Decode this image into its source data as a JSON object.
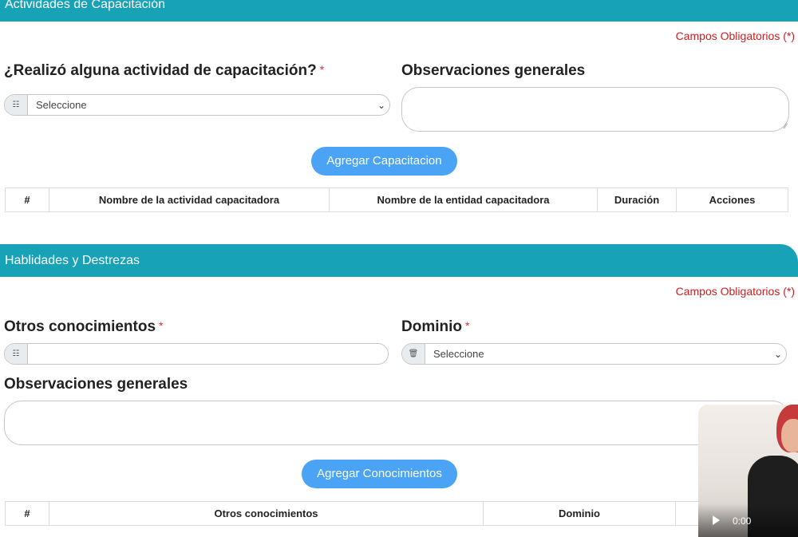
{
  "section1": {
    "title": "Actividades de Capacitación",
    "required_note": "Campos Obligatorios (*)",
    "question_label": "¿Realizó alguna actividad de capacitación?",
    "required_star": "*",
    "select_value": "Seleccione",
    "observations_label": "Observaciones generales",
    "add_button": "Agregar Capacitacion",
    "table_headers": [
      "#",
      "Nombre de la actividad capacitadora",
      "Nombre de la entidad capacitadora",
      "Duración",
      "Acciones"
    ]
  },
  "section2": {
    "title": "Hablidades y Destrezas",
    "required_note": "Campos Obligatorios (*)",
    "other_knowledge_label": "Otros conocimientos",
    "domain_label": "Dominio",
    "required_star": "*",
    "domain_select_value": "Seleccione",
    "observations_label": "Observaciones generales",
    "add_button": "Agregar Conocimientos",
    "table_headers": [
      "#",
      "Otros conocimientos",
      "Dominio",
      ""
    ]
  },
  "video": {
    "time": "0:00"
  },
  "icons": {
    "addon_icon": "document-icon",
    "domain_addon_icon": "trash-icon"
  }
}
